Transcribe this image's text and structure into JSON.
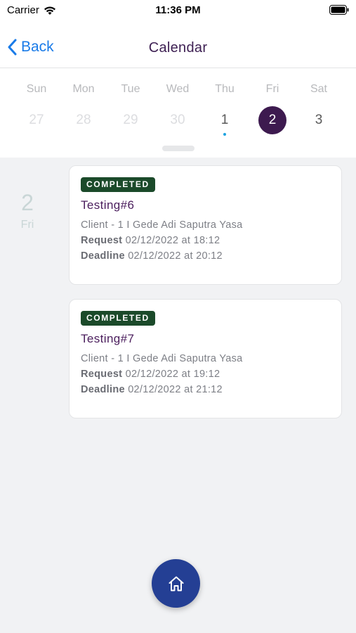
{
  "status_bar": {
    "carrier": "Carrier",
    "time": "11:36 PM"
  },
  "nav": {
    "back_label": "Back",
    "title": "Calendar"
  },
  "week": {
    "days": [
      {
        "name": "Sun",
        "num": "27",
        "state": "faded"
      },
      {
        "name": "Mon",
        "num": "28",
        "state": "faded"
      },
      {
        "name": "Tue",
        "num": "29",
        "state": "faded"
      },
      {
        "name": "Wed",
        "num": "30",
        "state": "faded"
      },
      {
        "name": "Thu",
        "num": "1",
        "state": "normal",
        "has_event": true
      },
      {
        "name": "Fri",
        "num": "2",
        "state": "selected"
      },
      {
        "name": "Sat",
        "num": "3",
        "state": "normal"
      }
    ]
  },
  "selected_date": {
    "num": "2",
    "day": "Fri"
  },
  "tasks": [
    {
      "status": "COMPLETED",
      "title": "Testing#6",
      "client": "Client - 1 I Gede Adi Saputra Yasa",
      "request_label": "Request",
      "request_value": "02/12/2022 at 18:12",
      "deadline_label": "Deadline",
      "deadline_value": "02/12/2022 at 20:12"
    },
    {
      "status": "COMPLETED",
      "title": "Testing#7",
      "client": "Client - 1 I Gede Adi Saputra Yasa",
      "request_label": "Request",
      "request_value": "02/12/2022 at 19:12",
      "deadline_label": "Deadline",
      "deadline_value": "02/12/2022 at 21:12"
    }
  ],
  "colors": {
    "accent_purple": "#3d1a4f",
    "badge_green": "#1b4a2a",
    "back_blue": "#1a7be8",
    "fab_blue": "#243f94"
  },
  "icons": {
    "fab": "home-icon",
    "back": "chevron-left-icon"
  }
}
